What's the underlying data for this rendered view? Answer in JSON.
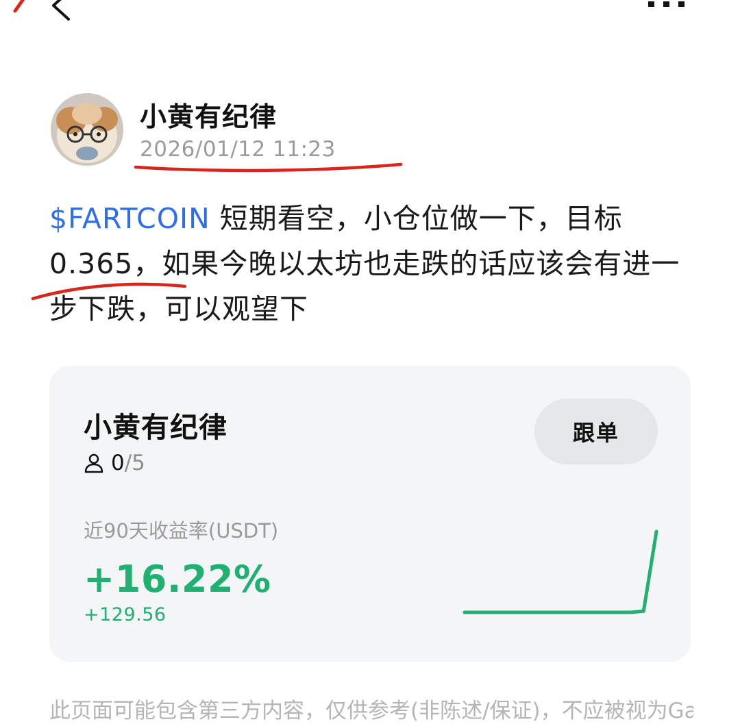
{
  "post": {
    "author": "小黄有纪律",
    "time": "2026/01/12 11:23",
    "ticker": "$FARTCOIN",
    "text_after_ticker": " 短期看空，小仓位做一下，目标 0.365，如果今晚以太坊也走跌的话应该会有进一步下跌，可以观望下"
  },
  "card": {
    "name": "小黄有纪律",
    "copy_button": "跟单",
    "followers_current": "0",
    "followers_max": "/5",
    "roi_label": "近90天收益率(USDT)",
    "roi_value": "+16.22%",
    "pnl_value": "+129.56",
    "sparkline": [
      0,
      0,
      0,
      0,
      0,
      0,
      0,
      0,
      0,
      0,
      0,
      0,
      0,
      0,
      0.015,
      1
    ]
  },
  "disclaimer": "此页面可能包含第三方内容，仅供参考(非陈述/保证)，不应被视为Gate",
  "colors": {
    "positive": "#1fb072",
    "ticker": "#2e6fe8",
    "annotation": "#d9261c"
  },
  "icons": {
    "back": "chevron-left-icon",
    "more": "more-dots-icon",
    "followers": "person-icon"
  }
}
